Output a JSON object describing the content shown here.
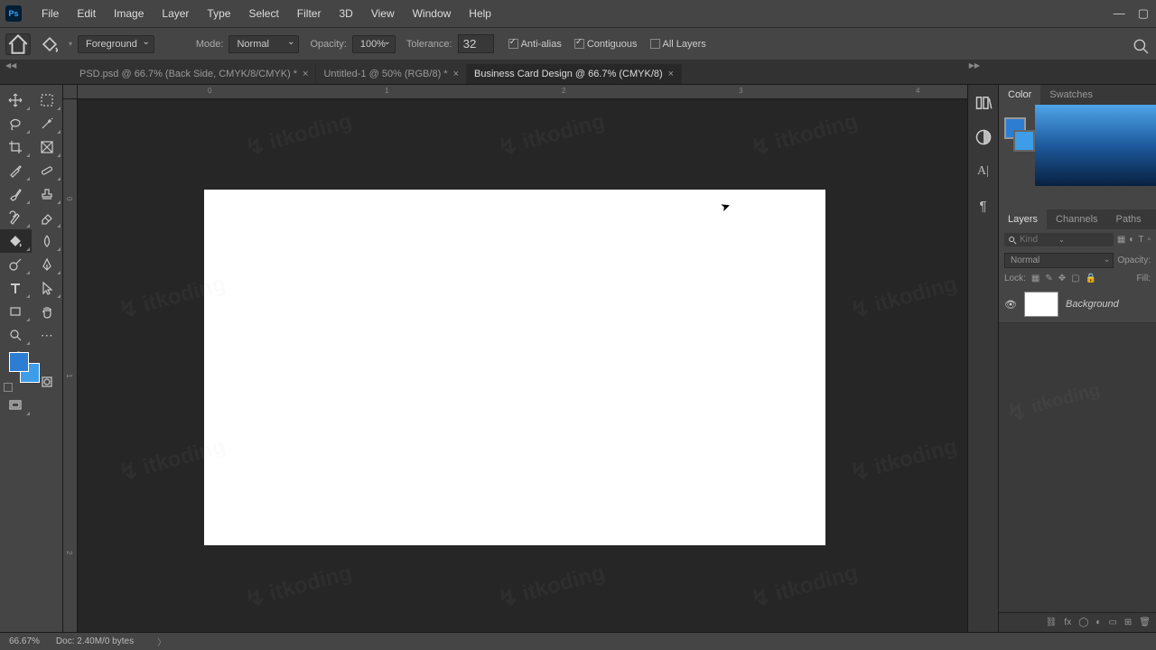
{
  "app": {
    "icon_text": "Ps"
  },
  "menu": {
    "file": "File",
    "edit": "Edit",
    "image": "Image",
    "layer": "Layer",
    "type": "Type",
    "select": "Select",
    "filter": "Filter",
    "threeD": "3D",
    "view": "View",
    "window": "Window",
    "help": "Help"
  },
  "options": {
    "fill_source": "Foreground",
    "mode_label": "Mode:",
    "mode_value": "Normal",
    "opacity_label": "Opacity:",
    "opacity_value": "100%",
    "tolerance_label": "Tolerance:",
    "tolerance_value": "32",
    "antialias_label": "Anti-alias",
    "contiguous_label": "Contiguous",
    "all_layers_label": "All Layers"
  },
  "tabs": [
    {
      "label": "PSD.psd @ 66.7% (Back Side, CMYK/8/CMYK) *",
      "active": false
    },
    {
      "label": "Untitled-1 @ 50% (RGB/8) *",
      "active": false
    },
    {
      "label": "Business Card Design @ 66.7% (CMYK/8)",
      "active": true
    }
  ],
  "ruler_h": {
    "t0": "0",
    "t1": "1",
    "t2": "2",
    "t3": "3",
    "t4": "4"
  },
  "ruler_v": {
    "t0": "0",
    "t1": "1",
    "t2": "2"
  },
  "right_panels": {
    "color_tab": "Color",
    "swatches_tab": "Swatches",
    "layers_tab": "Layers",
    "channels_tab": "Channels",
    "paths_tab": "Paths",
    "kind_placeholder": "Kind",
    "blend_mode": "Normal",
    "opacity_label": "Opacity:",
    "lock_label": "Lock:",
    "fill_label": "Fill:",
    "layer_name": "Background"
  },
  "status": {
    "zoom": "66.67%",
    "doc": "Doc: 2.40M/0 bytes"
  },
  "watermark_text": "itkoding",
  "colors": {
    "foreground": "#2d7dd2",
    "background": "#3d9de8"
  }
}
